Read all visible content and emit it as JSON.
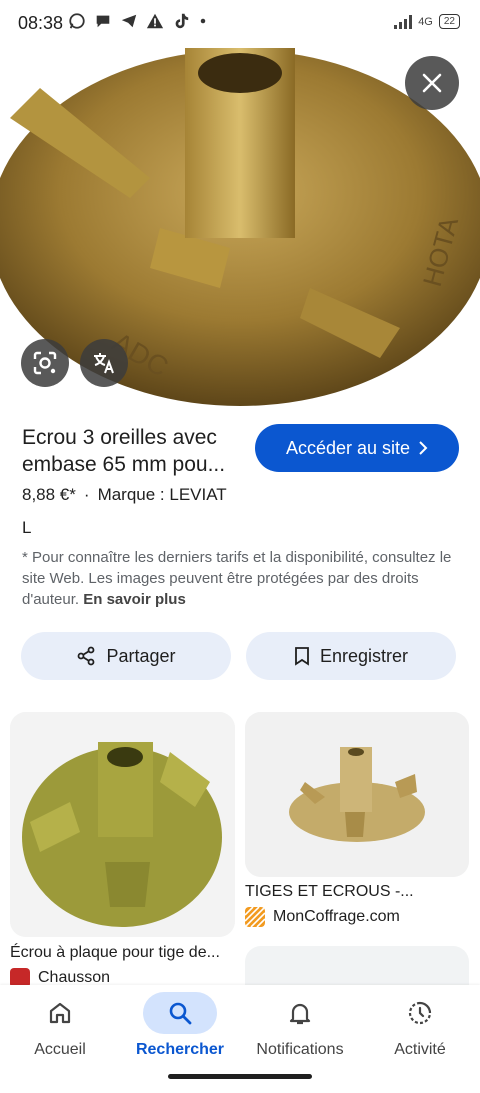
{
  "status_bar": {
    "time": "08:38",
    "network": "4G",
    "battery": "22"
  },
  "product": {
    "title": "Ecrou 3 oreilles avec embase 65 mm pou...",
    "price": "8,88 €*",
    "brand": "Marque : LEVIAT",
    "extra": "L",
    "disclaimer_text": "* Pour connaître les derniers tarifs et la disponibilité, consultez le site Web. Les images peuvent être protégées par des droits d'auteur.",
    "learn_more": "En savoir plus",
    "image_marks": {
      "left": "ADC",
      "right": "HOTA"
    }
  },
  "actions": {
    "visit_site": "Accéder au site",
    "share": "Partager",
    "save": "Enregistrer"
  },
  "related": [
    {
      "caption": "Écrou à plaque pour tige de...",
      "source": "Chausson",
      "favicon_color": "#c62828"
    },
    {
      "caption": "TIGES ET ECROUS -...",
      "source": "MonCoffrage.com",
      "favicon_color": "#f29a1f"
    }
  ],
  "bottom_nav": [
    {
      "label": "Accueil",
      "icon": "home-icon"
    },
    {
      "label": "Rechercher",
      "icon": "search-icon",
      "active": true
    },
    {
      "label": "Notifications",
      "icon": "bell-icon"
    },
    {
      "label": "Activité",
      "icon": "history-icon"
    }
  ],
  "colors": {
    "accent": "#0b57d0",
    "pill_bg": "#e8eef9",
    "active_nav_bg": "#d3e3fd"
  }
}
